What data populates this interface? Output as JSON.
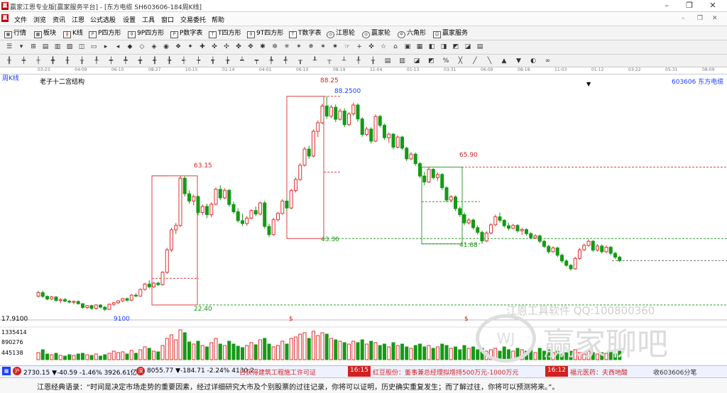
{
  "title_bar": {
    "title": "赢家江恩专业版[赢家服务平台] - [东方电缆  SH603606-184周K线]"
  },
  "menu": [
    "文件",
    "浏览",
    "资讯",
    "江恩",
    "公式选股",
    "设置",
    "工具",
    "窗口",
    "交易委托",
    "帮助"
  ],
  "nav": [
    {
      "icon": "grid-icon",
      "label": "行情"
    },
    {
      "icon": "blocks-icon",
      "label": "板块"
    },
    {
      "icon": "kline-icon",
      "label": "K线"
    },
    {
      "icon": "p-square-icon",
      "label": "P四方形"
    },
    {
      "icon": "9p-square-icon",
      "label": "9P四方形"
    },
    {
      "icon": "p-table-icon",
      "label": "P数字表"
    },
    {
      "icon": "t-square-icon",
      "label": "T四方形"
    },
    {
      "icon": "9t-square-icon",
      "label": "9T四方形"
    },
    {
      "icon": "t-table-icon",
      "label": "T数字表"
    },
    {
      "icon": "wheel-icon",
      "label": "江恩轮"
    },
    {
      "icon": "wheel-icon",
      "label": "赢家轮"
    },
    {
      "icon": "hexagon-icon",
      "label": "六角形"
    },
    {
      "icon": "service-icon",
      "label": "赢家服务"
    }
  ],
  "date_axis": [
    "03-23",
    "04-09",
    "06-10",
    "08-27",
    "10-15",
    "01-14",
    "04-01",
    "06-10",
    "08-19",
    "11-04",
    "01-13",
    "03-31",
    "06-09",
    "08-18",
    "11-03",
    "01-12",
    "03-22",
    "05-31",
    "08-09"
  ],
  "chart_header": {
    "period": "周K线",
    "structure": "老子十二宫结构",
    "code_name": "603606 东方电缆"
  },
  "price_labels": {
    "p1": "63.15",
    "p2": "88.25",
    "p3": "88.2500",
    "p4": "65.90",
    "p5": "43.36",
    "p6": "41.68",
    "p7": "22.40",
    "p8": "17.9100",
    "low": "9100",
    "dollar": "$"
  },
  "volume_axis": [
    "1335414",
    "890276",
    "445138"
  ],
  "watermark": {
    "tools": "江恩工具软件  QQ:100800360",
    "brand": "赢家聊吧"
  },
  "ticker": {
    "sh": "2730.15 ▼-40.59 -1.46% 3926.61亿",
    "sz": "8055.77 ▼-184.71 -2.24% 4130.2",
    "news1": "日获得建筑工程施工许可证",
    "time1": "16:15",
    "news2": "红豆股份：董事兼总经理拟增持500万元-1000万元",
    "time2": "16:12",
    "news3": "福元医药：夫西地酸",
    "right": "收603606分笔"
  },
  "quote": "江恩经典语录：“时间是决定市场走势的重要因素，经过详细研究大市及个别股票的过往记录，你将可以证明，历史确实重复发生；而了解过往，你将可以预测将来。”。",
  "chart_data": {
    "type": "candlestick",
    "symbol": "603606 东方电缆",
    "period": "周K线",
    "y_range": [
      17.9,
      92
    ],
    "up_color": "#e03030",
    "down_color": "#159a15",
    "ohlc": [
      [
        25.2,
        26.8,
        24.8,
        26.3
      ],
      [
        26.3,
        26.9,
        24.6,
        25.1
      ],
      [
        25.1,
        25.4,
        23.9,
        24.3
      ],
      [
        24.3,
        25.3,
        24.0,
        24.9
      ],
      [
        24.9,
        25.2,
        23.4,
        23.8
      ],
      [
        23.8,
        24.5,
        23.0,
        24.1
      ],
      [
        24.1,
        24.6,
        23.3,
        23.6
      ],
      [
        23.6,
        24.0,
        22.9,
        23.3
      ],
      [
        23.3,
        23.8,
        22.6,
        23.5
      ],
      [
        23.5,
        23.9,
        22.5,
        22.8
      ],
      [
        22.8,
        23.0,
        21.2,
        21.6
      ],
      [
        21.6,
        22.4,
        21.1,
        22.2
      ],
      [
        22.2,
        22.5,
        20.9,
        21.3
      ],
      [
        21.3,
        22.6,
        21.0,
        22.4
      ],
      [
        22.4,
        22.6,
        21.3,
        21.7
      ],
      [
        21.7,
        22.0,
        20.5,
        21.0
      ],
      [
        21.0,
        22.9,
        20.8,
        22.6
      ],
      [
        22.6,
        23.4,
        22.1,
        23.1
      ],
      [
        23.1,
        23.9,
        22.7,
        23.7
      ],
      [
        23.7,
        24.6,
        23.3,
        24.4
      ],
      [
        24.4,
        24.7,
        23.4,
        23.9
      ],
      [
        23.9,
        25.8,
        23.6,
        25.5
      ],
      [
        25.5,
        26.1,
        24.9,
        25.2
      ],
      [
        25.2,
        27.6,
        25.0,
        27.3
      ],
      [
        27.3,
        29.4,
        26.9,
        29.0
      ],
      [
        29.0,
        30.2,
        27.6,
        28.1
      ],
      [
        28.1,
        29.6,
        27.9,
        29.3
      ],
      [
        29.3,
        29.8,
        28.4,
        28.8
      ],
      [
        28.8,
        33.1,
        28.5,
        32.7
      ],
      [
        32.7,
        40.4,
        32.2,
        39.8
      ],
      [
        39.8,
        46.8,
        39.1,
        46.1
      ],
      [
        46.1,
        48.3,
        44.8,
        47.5
      ],
      [
        47.5,
        63.15,
        47.0,
        62.4
      ],
      [
        62.4,
        63.0,
        56.6,
        57.5
      ],
      [
        57.5,
        58.5,
        54.4,
        55.2
      ],
      [
        55.2,
        57.2,
        53.8,
        56.6
      ],
      [
        56.6,
        56.9,
        50.7,
        51.6
      ],
      [
        51.6,
        54.1,
        50.8,
        53.5
      ],
      [
        53.5,
        54.4,
        49.8,
        50.9
      ],
      [
        50.9,
        54.8,
        50.1,
        54.2
      ],
      [
        54.2,
        59.5,
        53.8,
        58.9
      ],
      [
        58.9,
        60.2,
        55.5,
        56.2
      ],
      [
        56.2,
        59.2,
        55.8,
        58.6
      ],
      [
        58.6,
        59.0,
        53.4,
        54.1
      ],
      [
        54.1,
        55.0,
        51.2,
        51.8
      ],
      [
        51.8,
        52.9,
        48.4,
        49.0
      ],
      [
        49.0,
        51.2,
        47.3,
        48.1
      ],
      [
        48.1,
        50.4,
        47.4,
        49.8
      ],
      [
        49.8,
        52.6,
        49.4,
        52.2
      ],
      [
        52.2,
        53.5,
        50.4,
        51.1
      ],
      [
        51.1,
        55.0,
        50.7,
        54.6
      ],
      [
        54.6,
        55.3,
        46.5,
        47.2
      ],
      [
        47.2,
        48.0,
        43.8,
        44.6
      ],
      [
        44.6,
        49.9,
        44.2,
        49.3
      ],
      [
        49.3,
        51.8,
        48.8,
        51.3
      ],
      [
        51.3,
        55.8,
        50.9,
        55.2
      ],
      [
        55.2,
        56.2,
        52.0,
        53.0
      ],
      [
        53.0,
        59.1,
        52.6,
        58.5
      ],
      [
        58.5,
        62.6,
        57.9,
        62.0
      ],
      [
        62.0,
        67.2,
        61.6,
        66.5
      ],
      [
        66.5,
        72.3,
        66.1,
        71.6
      ],
      [
        71.6,
        72.6,
        68.5,
        69.4
      ],
      [
        69.4,
        77.8,
        69.0,
        77.2
      ],
      [
        77.2,
        80.6,
        75.4,
        79.9
      ],
      [
        79.9,
        85.9,
        79.4,
        85.2
      ],
      [
        85.2,
        88.25,
        81.1,
        82.0
      ],
      [
        82.0,
        85.5,
        81.3,
        84.8
      ],
      [
        84.8,
        85.7,
        80.1,
        81.0
      ],
      [
        81.0,
        84.4,
        80.6,
        83.6
      ],
      [
        83.6,
        84.5,
        78.5,
        79.3
      ],
      [
        79.3,
        83.2,
        78.9,
        82.7
      ],
      [
        82.7,
        86.2,
        82.1,
        85.5
      ],
      [
        85.5,
        86.0,
        80.2,
        81.1
      ],
      [
        81.1,
        81.7,
        75.5,
        76.2
      ],
      [
        76.2,
        78.6,
        75.7,
        77.9
      ],
      [
        77.9,
        78.5,
        73.3,
        74.1
      ],
      [
        74.1,
        82.5,
        73.8,
        81.9
      ],
      [
        81.9,
        82.4,
        78.4,
        79.1
      ],
      [
        79.1,
        79.6,
        74.5,
        75.2
      ],
      [
        75.2,
        76.8,
        73.6,
        76.3
      ],
      [
        76.3,
        76.7,
        71.5,
        72.2
      ],
      [
        72.2,
        75.9,
        71.8,
        75.4
      ],
      [
        75.4,
        75.8,
        71.3,
        71.9
      ],
      [
        71.9,
        72.4,
        67.8,
        68.5
      ],
      [
        68.5,
        70.6,
        68.1,
        70.0
      ],
      [
        70.0,
        70.5,
        66.3,
        67.0
      ],
      [
        67.0,
        67.6,
        62.5,
        63.1
      ],
      [
        63.1,
        64.4,
        60.2,
        61.2
      ],
      [
        61.2,
        65.8,
        60.9,
        65.2
      ],
      [
        65.2,
        65.6,
        62.0,
        62.6
      ],
      [
        62.6,
        64.2,
        61.6,
        63.6
      ],
      [
        63.6,
        64.0,
        58.7,
        59.4
      ],
      [
        59.4,
        59.9,
        54.8,
        55.5
      ],
      [
        55.5,
        57.1,
        54.9,
        56.5
      ],
      [
        56.5,
        57.0,
        52.1,
        52.8
      ],
      [
        52.8,
        53.5,
        50.2,
        50.9
      ],
      [
        50.9,
        51.6,
        47.6,
        48.3
      ],
      [
        48.3,
        49.8,
        47.8,
        49.2
      ],
      [
        49.2,
        49.6,
        46.2,
        46.8
      ],
      [
        46.8,
        47.5,
        44.6,
        45.3
      ],
      [
        45.3,
        45.9,
        41.68,
        42.6
      ],
      [
        42.6,
        45.7,
        42.2,
        45.1
      ],
      [
        45.1,
        48.2,
        44.7,
        47.7
      ],
      [
        47.7,
        50.9,
        47.3,
        50.2
      ],
      [
        50.2,
        51.6,
        48.4,
        49.1
      ],
      [
        49.1,
        49.5,
        46.8,
        47.4
      ],
      [
        47.4,
        48.3,
        45.9,
        46.6
      ],
      [
        46.6,
        48.0,
        46.2,
        47.5
      ],
      [
        47.5,
        47.9,
        45.2,
        45.8
      ],
      [
        45.8,
        46.7,
        44.6,
        46.2
      ],
      [
        46.2,
        46.6,
        44.3,
        44.9
      ],
      [
        44.9,
        45.4,
        43.1,
        43.6
      ],
      [
        43.6,
        44.7,
        43.2,
        44.2
      ],
      [
        44.2,
        44.6,
        41.9,
        42.5
      ],
      [
        42.5,
        42.9,
        40.4,
        40.9
      ],
      [
        40.9,
        41.4,
        38.6,
        39.2
      ],
      [
        39.2,
        40.9,
        38.9,
        40.4
      ],
      [
        40.4,
        40.8,
        37.5,
        38.1
      ],
      [
        38.1,
        38.6,
        35.6,
        36.3
      ],
      [
        36.3,
        36.8,
        34.4,
        34.9
      ],
      [
        34.9,
        35.4,
        33.2,
        33.8
      ],
      [
        33.8,
        37.6,
        33.5,
        37.1
      ],
      [
        37.1,
        40.4,
        36.7,
        39.8
      ],
      [
        39.8,
        41.8,
        39.4,
        41.2
      ],
      [
        41.2,
        43.1,
        40.8,
        42.5
      ],
      [
        42.5,
        42.9,
        39.1,
        39.7
      ],
      [
        39.7,
        41.6,
        39.3,
        41.0
      ],
      [
        41.0,
        41.5,
        38.6,
        39.2
      ],
      [
        39.2,
        41.2,
        38.8,
        40.6
      ],
      [
        40.6,
        41.1,
        38.1,
        38.7
      ],
      [
        38.7,
        39.2,
        36.9,
        37.5
      ],
      [
        37.5,
        37.9,
        35.9,
        36.4
      ]
    ],
    "volume": [
      10,
      14,
      8,
      7,
      9,
      6,
      5,
      7,
      6,
      8,
      9,
      7,
      6,
      8,
      5,
      7,
      9,
      12,
      10,
      11,
      8,
      13,
      9,
      14,
      18,
      16,
      12,
      11,
      20,
      30,
      35,
      28,
      42,
      38,
      25,
      22,
      26,
      20,
      18,
      24,
      30,
      22,
      20,
      26,
      22,
      19,
      17,
      20,
      24,
      21,
      28,
      30,
      22,
      18,
      20,
      26,
      22,
      30,
      32,
      36,
      38,
      30,
      40,
      34,
      38,
      36,
      30,
      28,
      26,
      24,
      22,
      26,
      24,
      28,
      22,
      26,
      24,
      20,
      22,
      18,
      24,
      20,
      22,
      18,
      16,
      20,
      22,
      18,
      20,
      16,
      18,
      22,
      20,
      16,
      18,
      14,
      20,
      16,
      18,
      14,
      16,
      12,
      14,
      16,
      12,
      18,
      14,
      12,
      16,
      14,
      12,
      14,
      10,
      16,
      12,
      14,
      10,
      12,
      8,
      10,
      12,
      14,
      10,
      8,
      12,
      10,
      8,
      10,
      9,
      11,
      8,
      12
    ]
  }
}
